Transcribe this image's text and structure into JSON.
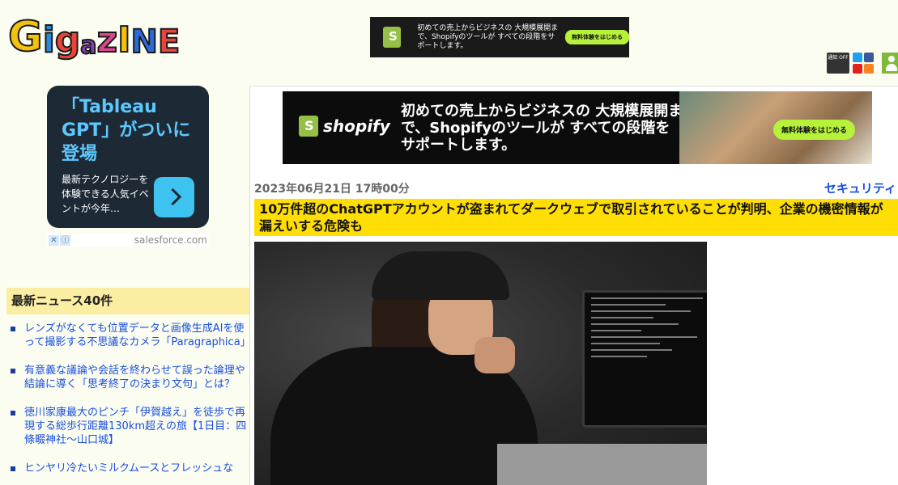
{
  "logo": {
    "letters": [
      "G",
      "i",
      "g",
      "a",
      "z",
      "I",
      "N",
      "E"
    ],
    "text": "GigazINE"
  },
  "top_banner": {
    "brand": "shopify",
    "copy": "初めての売上からビジネスの 大規模展開まで、Shopifyのツールが すべての段階をサポートします。",
    "cta": "無料体験をはじめる"
  },
  "header_icons": {
    "notify": "通知 OFF",
    "twitter": "twitter-icon",
    "facebook": "facebook-icon",
    "youtube": "youtube-icon",
    "rss": "rss-icon",
    "user": "user-icon"
  },
  "side_ad": {
    "headline": "「Tableau GPT」がついに登場",
    "sub": "最新テクノロジーを体験できる人気イベントが今年…",
    "close": "✕",
    "info": "ⓘ",
    "source": "salesforce.com"
  },
  "news": {
    "heading": "最新ニュース40件",
    "items": [
      "レンズがなくても位置データと画像生成AIを使って撮影する不思議なカメラ「Paragraphica」",
      "有意義な議論や会話を終わらせて誤った論理や結論に導く「思考終了の決まり文句」とは？",
      "徳川家康最大のピンチ「伊賀越え」を徒歩で再現する総歩行距離130km超えの旅【1日目：四條畷神社～山口城】",
      "ヒンヤリ冷たいミルクムースとフレッシュな"
    ]
  },
  "main_banner": {
    "brand": "shopify",
    "copy": "初めての売上からビジネスの 大規模展開まで、Shopifyのツールが すべての段階をサポートします。",
    "cta": "無料体験をはじめる"
  },
  "article": {
    "date": "2023年06月21日 17時00分",
    "category": "セキュリティ",
    "title": "10万件超のChatGPTアカウントが盗まれてダークウェブで取引されていることが判明、企業の機密情報が漏えいする危険も"
  }
}
